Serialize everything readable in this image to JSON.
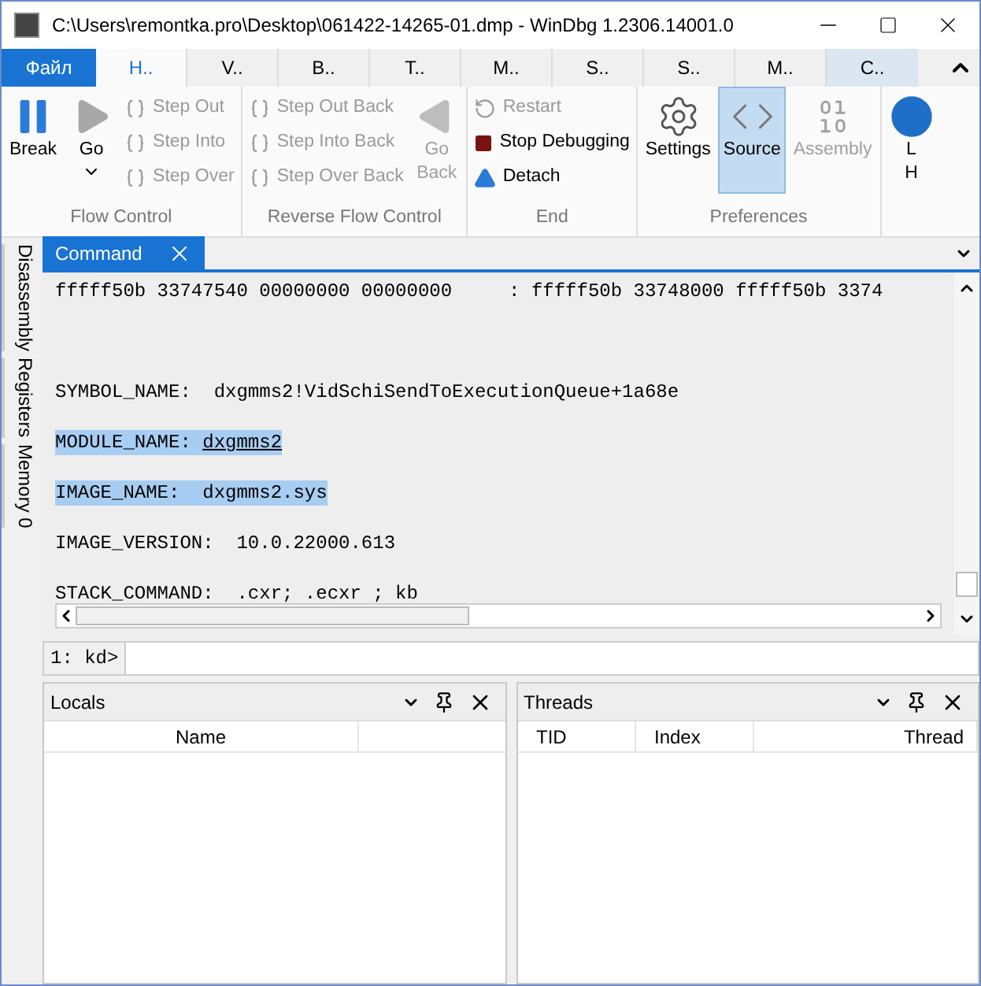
{
  "window": {
    "title": "C:\\Users\\remontka.pro\\Desktop\\061422-14265-01.dmp - WinDbg 1.2306.14001.0"
  },
  "tabs": [
    {
      "label": "Файл",
      "kind": "file",
      "selected": false
    },
    {
      "label": "H..",
      "kind": "tab",
      "selected": true
    },
    {
      "label": "V..",
      "kind": "tab",
      "selected": false
    },
    {
      "label": "B..",
      "kind": "tab",
      "selected": false
    },
    {
      "label": "T..",
      "kind": "tab",
      "selected": false
    },
    {
      "label": "M..",
      "kind": "tab",
      "selected": false
    },
    {
      "label": "S..",
      "kind": "tab",
      "selected": false
    },
    {
      "label": "S..",
      "kind": "tab",
      "selected": false
    },
    {
      "label": "M..",
      "kind": "tab",
      "selected": false
    },
    {
      "label": "C..",
      "kind": "context",
      "selected": false
    }
  ],
  "ribbon": [
    {
      "label": "Flow Control",
      "buttons": [
        {
          "kind": "large",
          "label": "Break",
          "disabled": false
        },
        {
          "kind": "large",
          "label": "Go",
          "disabled": false,
          "dropdown": true
        },
        {
          "kind": "stack",
          "items": [
            {
              "label": "Step Out",
              "disabled": true
            },
            {
              "label": "Step Into",
              "disabled": true
            },
            {
              "label": "Step Over",
              "disabled": true
            }
          ]
        }
      ]
    },
    {
      "label": "Reverse Flow Control",
      "buttons": [
        {
          "kind": "stack",
          "items": [
            {
              "label": "Step Out Back",
              "disabled": true
            },
            {
              "label": "Step Into Back",
              "disabled": true
            },
            {
              "label": "Step Over Back",
              "disabled": true
            }
          ]
        },
        {
          "kind": "large",
          "label": "Go\nBack",
          "disabled": true
        }
      ]
    },
    {
      "label": "End",
      "buttons": [
        {
          "kind": "stack",
          "items": [
            {
              "label": "Restart",
              "disabled": true
            },
            {
              "label": "Stop Debugging",
              "disabled": false
            },
            {
              "label": "Detach",
              "disabled": false
            }
          ]
        }
      ]
    },
    {
      "label": "Preferences",
      "buttons": [
        {
          "kind": "large",
          "label": "Settings",
          "disabled": false,
          "selected": false
        },
        {
          "kind": "large",
          "label": "Source",
          "disabled": false,
          "selected": true
        },
        {
          "kind": "large",
          "label": "Assembly",
          "disabled": true,
          "selected": false
        }
      ]
    },
    {
      "buttons": [
        {
          "kind": "large",
          "label": "L\nH"
        }
      ]
    }
  ],
  "side_tabs": [
    "Disassembly",
    "Registers",
    "Memory 0"
  ],
  "command": {
    "title": "Command",
    "lines": [
      {
        "text": "fffff50b 33747540 00000000 00000000     : fffff50b 33748000 fffff50b 3374",
        "selected": false
      },
      {
        "text": "SYMBOL_NAME:  dxgmms2!VidSchiSendToExecutionQueue+1a68e",
        "selected": false
      },
      {
        "text": "MODULE_NAME: ",
        "link": "dxgmms2",
        "selected": true
      },
      {
        "text": "IMAGE_NAME:  dxgmms2.sys",
        "selected": true
      },
      {
        "text": "IMAGE_VERSION:  10.0.22000.613",
        "selected": false
      },
      {
        "text": "STACK_COMMAND:  .cxr; .ecxr ; kb",
        "selected": false
      }
    ],
    "prompt": "1: kd>"
  },
  "panels": [
    {
      "title": "Locals",
      "columns": [
        "Name"
      ]
    },
    {
      "title": "Threads",
      "columns": [
        "TID",
        "Index",
        "Thread"
      ]
    }
  ]
}
